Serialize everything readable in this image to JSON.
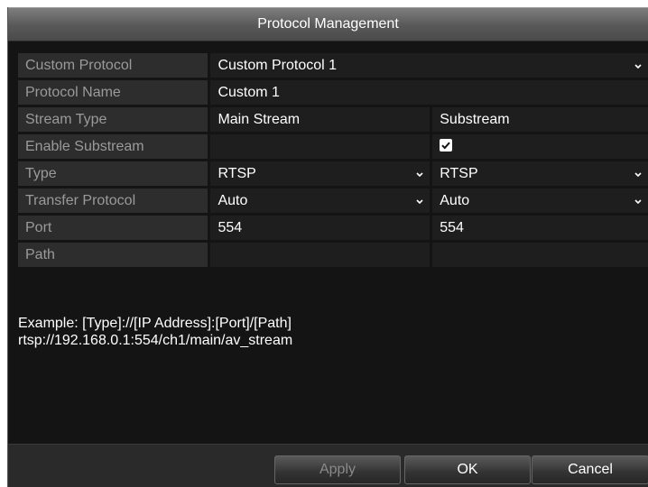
{
  "dialog": {
    "title": "Protocol Management"
  },
  "rows": {
    "custom_protocol": {
      "label": "Custom Protocol",
      "value": "Custom Protocol 1"
    },
    "protocol_name": {
      "label": "Protocol Name",
      "value": "Custom 1"
    },
    "stream_type": {
      "label": "Stream Type",
      "main": "Main Stream",
      "sub": "Substream"
    },
    "enable_substream": {
      "label": "Enable Substream",
      "checked": true
    },
    "type": {
      "label": "Type",
      "main": "RTSP",
      "sub": "RTSP"
    },
    "transfer_protocol": {
      "label": "Transfer Protocol",
      "main": "Auto",
      "sub": "Auto"
    },
    "port": {
      "label": "Port",
      "main": "554",
      "sub": "554"
    },
    "path": {
      "label": "Path",
      "main": "",
      "sub": ""
    }
  },
  "example": {
    "line1": "Example: [Type]://[IP Address]:[Port]/[Path]",
    "line2": "rtsp://192.168.0.1:554/ch1/main/av_stream"
  },
  "buttons": {
    "apply": "Apply",
    "ok": "OK",
    "cancel": "Cancel"
  },
  "icons": {
    "dropdown": "chevron-down-icon",
    "checkbox": "checkmark-icon"
  },
  "colors": {
    "background": "#141414",
    "label_cell": "#2d2d2d",
    "value_cell": "#1e1e1e",
    "label_text": "#9a9a9a",
    "text": "#ffffff"
  }
}
